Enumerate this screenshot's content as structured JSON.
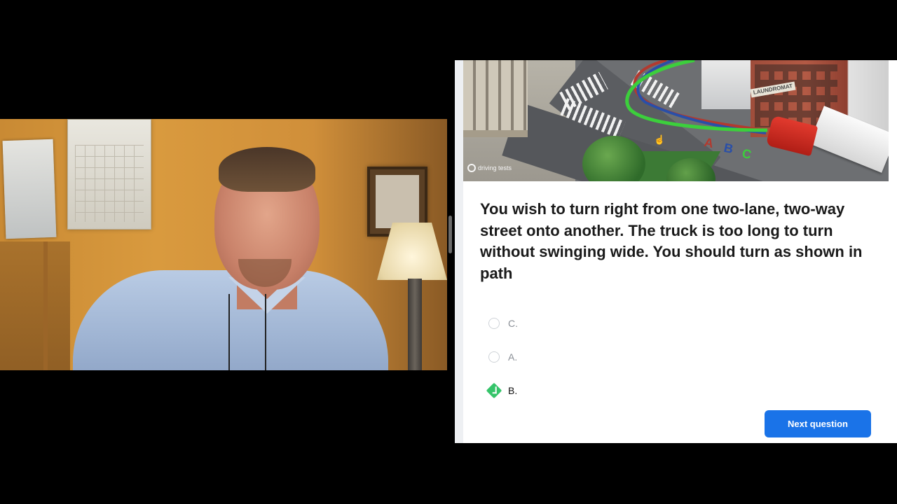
{
  "quiz": {
    "question": "You wish to turn right from one two-lane, two-way street onto another. The truck is too long to turn without swinging wide. You should turn as shown in path",
    "options": [
      {
        "label": "C.",
        "state": "unselected"
      },
      {
        "label": "A.",
        "state": "unselected"
      },
      {
        "label": "B.",
        "state": "correct"
      }
    ],
    "next_button": "Next question",
    "accent_color": "#1a73e8",
    "correct_color": "#35c46a"
  },
  "illustration": {
    "path_labels": [
      "A",
      "B",
      "C"
    ],
    "path_colors": {
      "A": "#b23a2f",
      "B": "#2a4fa8",
      "C": "#3ccf3c"
    },
    "store_sign": "LAUNDROMAT",
    "logo_text": "driving tests"
  }
}
